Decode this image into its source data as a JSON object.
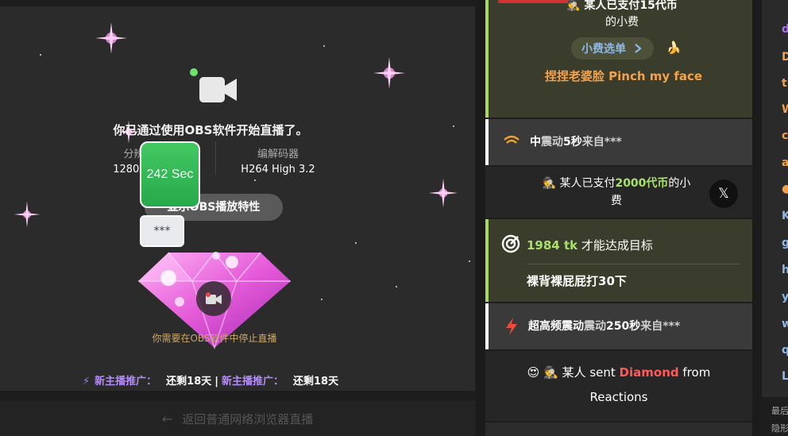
{
  "stream": {
    "obs_notice": "你已通过使用OBS软件开始直播了。",
    "resolution_label": "分辨率",
    "resolution_value": "1280x720",
    "codec_label": "编解码器",
    "codec_value": "H264 High 3.2",
    "show_obs_button": "显示OBS播放特性",
    "timer_badge": "242 Sec",
    "masked_badge": "***",
    "stop_hint": "你需要在OBS软件中停止直播",
    "promo_label": "新主播推广：",
    "promo_value": "还剩18天",
    "promo_separator": "|",
    "back_link": "返回普通网络浏览器直播",
    "colors": {
      "online_dot": "#6ee06e",
      "timer_bg": "#2fb553",
      "accent_purple": "#b48cf7"
    }
  },
  "feed": {
    "tip_menu_line1": "🕵 某人已支付15代币",
    "tip_menu_line2": "的小费",
    "tip_menu_button": "小费选单",
    "tip_menu_button_icon": "chevron-right-icon",
    "tip_menu_item": "捏捏老婆脸 Pinch my face",
    "vibe1_strength": "中",
    "vibe1_text": "震动",
    "vibe1_duration": "5秒",
    "vibe1_from": "来自***",
    "tip2_prefix": "🕵 某人已支付",
    "tip2_amount": "2000代币",
    "tip2_suffix": "的小费",
    "close_button": "𝕏",
    "goal_number": "1984 tk",
    "goal_text": "才能达成目标",
    "goal_desc": "裸背裸屁屁打30下",
    "vibe2_strength": "超高频震动",
    "vibe2_text": "震动",
    "vibe2_duration": "250秒",
    "vibe2_from": "来自***",
    "reaction_emoji": "😍",
    "reaction_user": "🕵 某人",
    "reaction_sent": "sent",
    "reaction_gift": "Diamond",
    "reaction_from": "from",
    "reaction_source": "Reactions",
    "colors": {
      "green_accent": "#a6d96a",
      "orange": "#f4a24a",
      "gift_red": "#ff5a5a"
    }
  },
  "chat": {
    "letters": [
      "d",
      "D",
      "tr",
      "W",
      "c",
      "a",
      "●",
      "K",
      "g",
      "h",
      "y",
      "w",
      "q",
      "L"
    ],
    "footer1": "最后",
    "footer2": "隐形"
  }
}
